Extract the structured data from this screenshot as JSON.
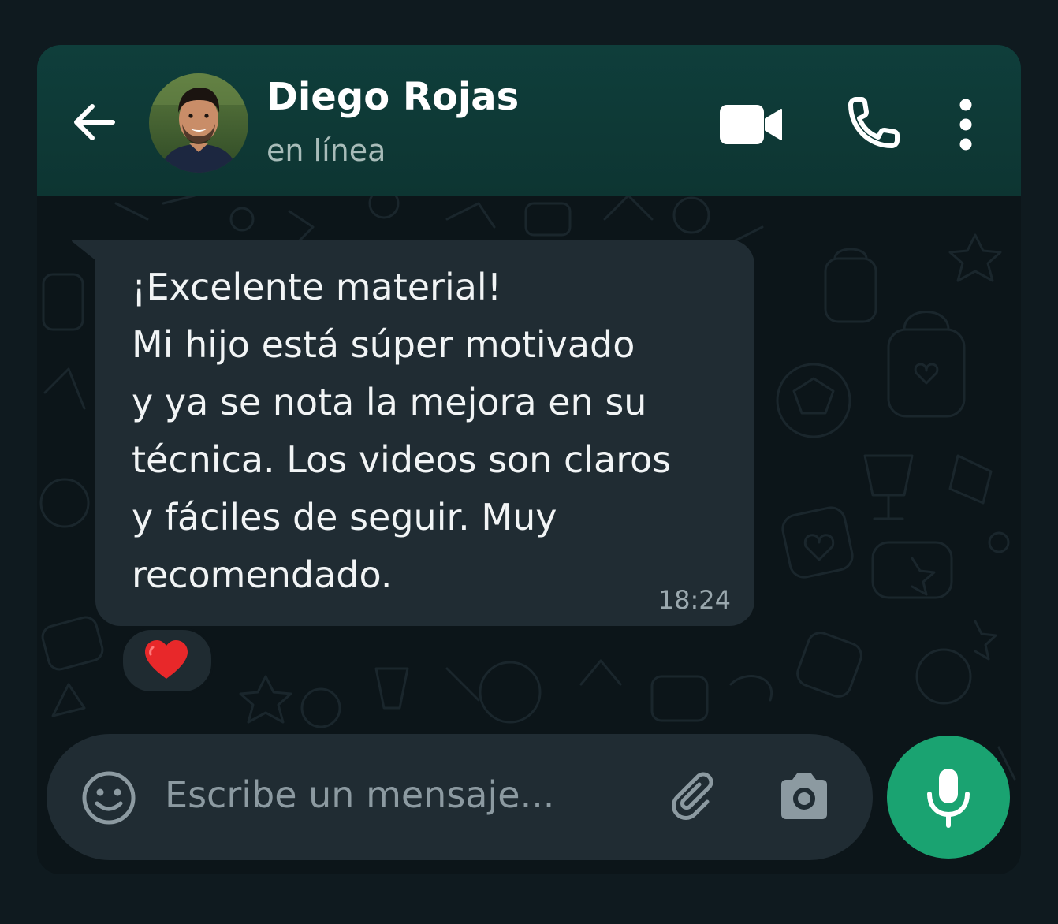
{
  "header": {
    "contact_name": "Diego Rojas",
    "status": "en línea",
    "icons": [
      "back-arrow-icon",
      "video-call-icon",
      "phone-call-icon",
      "more-options-icon"
    ]
  },
  "message": {
    "text": "¡Excelente material!\nMi hijo está súper motivado\ny ya se nota la mejora en su\ntécnica. Los videos son claros\ny fáciles de seguir. Muy\nrecomendado.",
    "time": "18:24",
    "reaction": "heart"
  },
  "composer": {
    "placeholder": "Escribe un mensaje...",
    "icons": [
      "emoji-icon",
      "attach-icon",
      "camera-icon",
      "microphone-icon"
    ]
  },
  "colors": {
    "header_bg": "#0d3532",
    "chat_bg": "#0c1519",
    "bubble_bg": "#202c33",
    "accent_green": "#1aa371",
    "heart_red": "#e8282a"
  }
}
